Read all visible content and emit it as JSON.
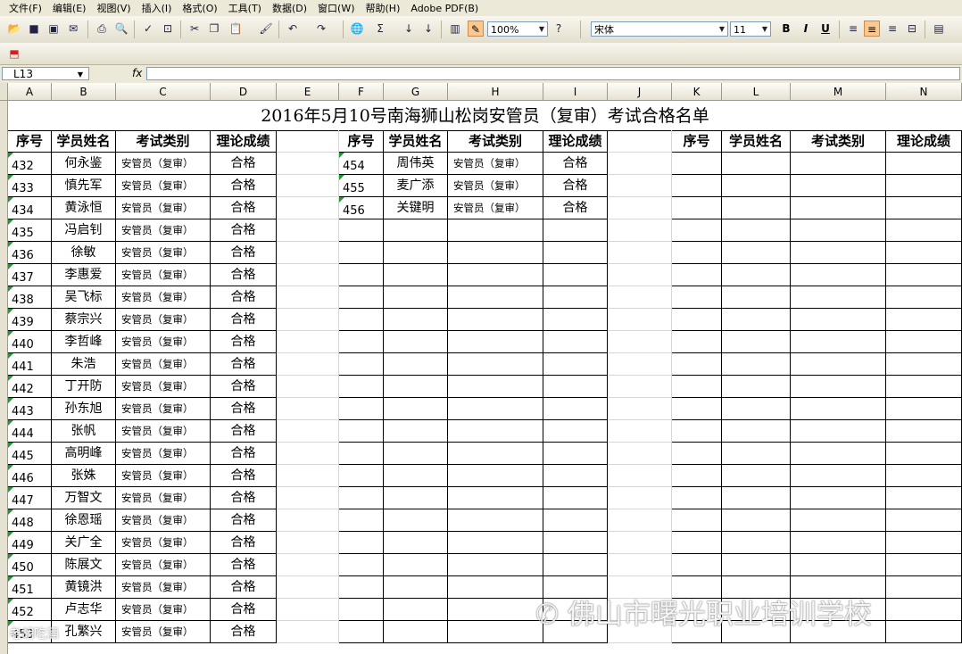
{
  "menu": [
    "文件(F)",
    "编辑(E)",
    "视图(V)",
    "插入(I)",
    "格式(O)",
    "工具(T)",
    "数据(D)",
    "窗口(W)",
    "帮助(H)",
    "Adobe PDF(B)"
  ],
  "toolbar": {
    "zoom": "100%",
    "font": "宋体",
    "font_size": "11",
    "bold": "B",
    "italic": "I",
    "underline": "U"
  },
  "formula_bar": {
    "cell_ref": "L13",
    "fx": "fx",
    "value": ""
  },
  "columns": [
    "A",
    "B",
    "C",
    "D",
    "E",
    "F",
    "G",
    "H",
    "I",
    "J",
    "K",
    "L",
    "M",
    "N"
  ],
  "sheet": {
    "title": "2016年5月10号南海狮山松岗安管员（复审）考试合格名单",
    "headers": [
      "序号",
      "学员姓名",
      "考试类别",
      "理论成绩"
    ],
    "block1": [
      [
        "432",
        "何永鉴",
        "安管员（复审）",
        "合格"
      ],
      [
        "433",
        "慎先军",
        "安管员（复审）",
        "合格"
      ],
      [
        "434",
        "黄泳恒",
        "安管员（复审）",
        "合格"
      ],
      [
        "435",
        "冯启钊",
        "安管员（复审）",
        "合格"
      ],
      [
        "436",
        "徐敏",
        "安管员（复审）",
        "合格"
      ],
      [
        "437",
        "李惠爱",
        "安管员（复审）",
        "合格"
      ],
      [
        "438",
        "吴飞标",
        "安管员（复审）",
        "合格"
      ],
      [
        "439",
        "蔡宗兴",
        "安管员（复审）",
        "合格"
      ],
      [
        "440",
        "李哲峰",
        "安管员（复审）",
        "合格"
      ],
      [
        "441",
        "朱浩",
        "安管员（复审）",
        "合格"
      ],
      [
        "442",
        "丁开防",
        "安管员（复审）",
        "合格"
      ],
      [
        "443",
        "孙东旭",
        "安管员（复审）",
        "合格"
      ],
      [
        "444",
        "张帆",
        "安管员（复审）",
        "合格"
      ],
      [
        "445",
        "高明峰",
        "安管员（复审）",
        "合格"
      ],
      [
        "446",
        "张姝",
        "安管员（复审）",
        "合格"
      ],
      [
        "447",
        "万智文",
        "安管员（复审）",
        "合格"
      ],
      [
        "448",
        "徐恩瑶",
        "安管员（复审）",
        "合格"
      ],
      [
        "449",
        "关广全",
        "安管员（复审）",
        "合格"
      ],
      [
        "450",
        "陈展文",
        "安管员（复审）",
        "合格"
      ],
      [
        "451",
        "黄镜洪",
        "安管员（复审）",
        "合格"
      ],
      [
        "452",
        "卢志华",
        "安管员（复审）",
        "合格"
      ],
      [
        "453",
        "孔繁兴",
        "安管员（复审）",
        "合格"
      ]
    ],
    "block2": [
      [
        "454",
        "周伟英",
        "安管员（复审）",
        "合格"
      ],
      [
        "455",
        "麦广添",
        "安管员（复审）",
        "合格"
      ],
      [
        "456",
        "关键明",
        "安管员（复审）",
        "合格"
      ]
    ]
  },
  "watermark": "佛山市曙光职业培训学校",
  "watermark_small": "老胡吃酒"
}
